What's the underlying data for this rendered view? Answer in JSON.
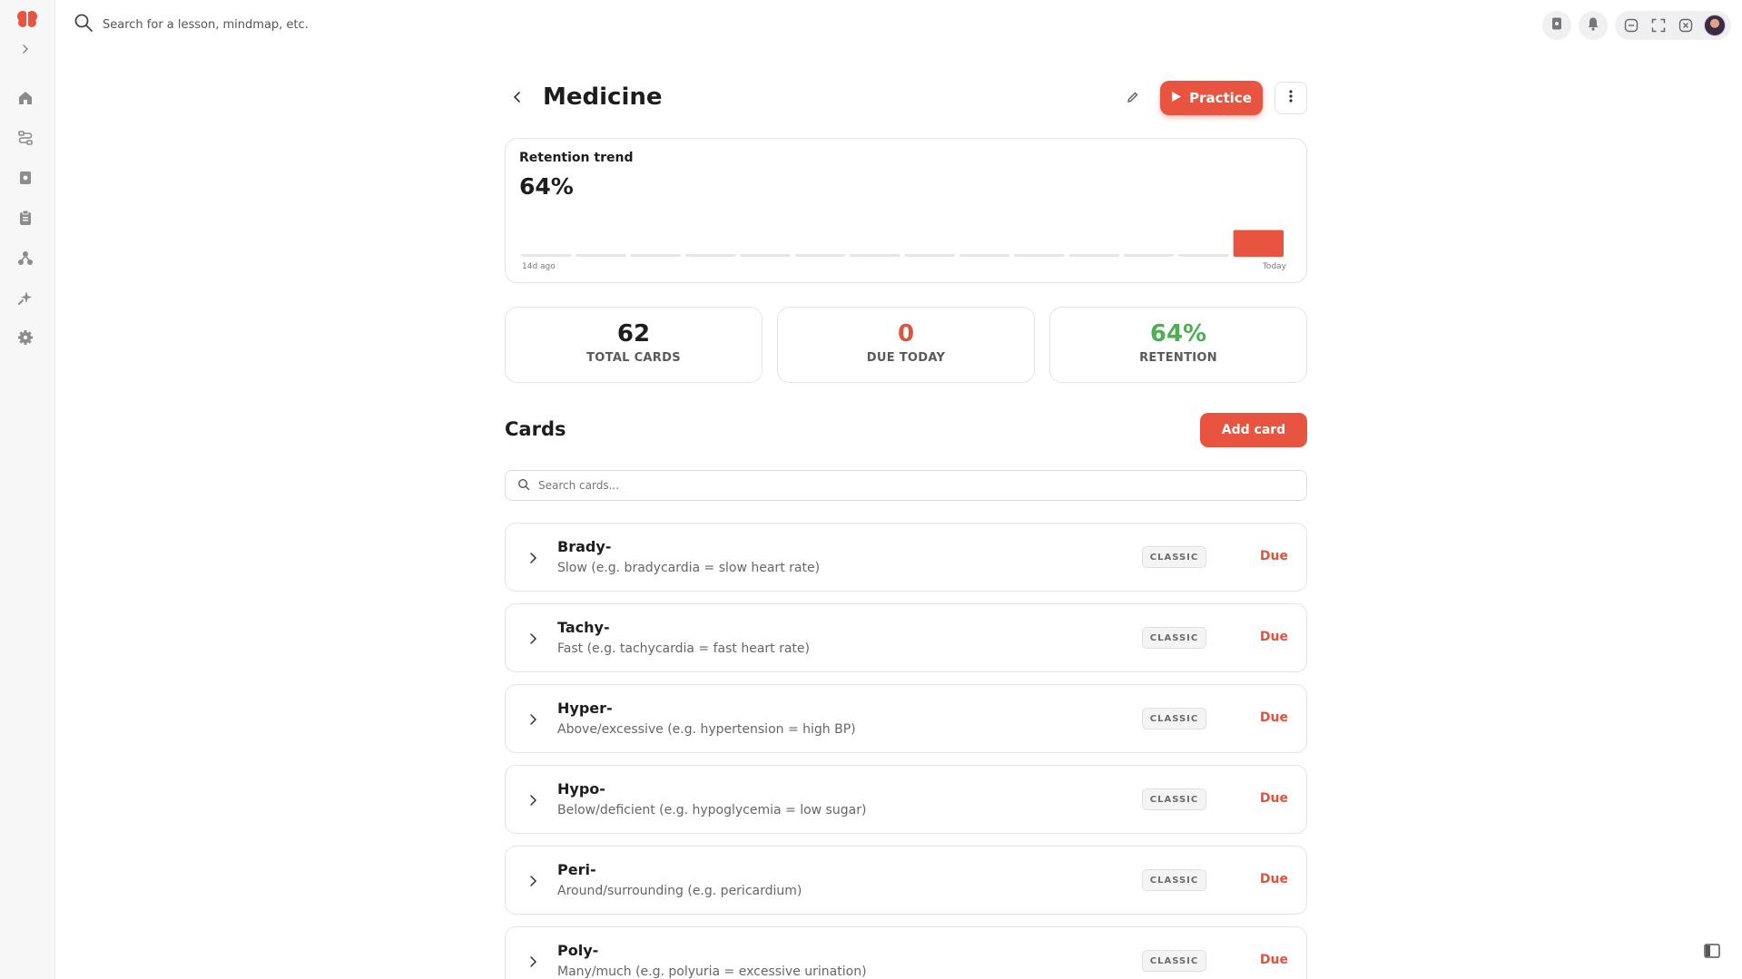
{
  "topbar": {
    "search_placeholder": "Search for a lesson, mindmap, etc."
  },
  "sidebar": {
    "items": [
      {
        "icon": "home-icon"
      },
      {
        "icon": "flow-icon"
      },
      {
        "icon": "deck-icon"
      },
      {
        "icon": "clipboard-icon"
      },
      {
        "icon": "mindmap-icon"
      },
      {
        "icon": "sparkle-icon"
      },
      {
        "icon": "gear-icon"
      }
    ]
  },
  "deck": {
    "title": "Medicine",
    "practice_label": "Practice"
  },
  "trend": {
    "label": "Retention trend",
    "value": "64%",
    "axis_start": "14d ago",
    "axis_end": "Today",
    "days": 14,
    "today_value": 64
  },
  "stats": [
    {
      "value": "62",
      "label": "TOTAL CARDS",
      "color": "#1d1d1f"
    },
    {
      "value": "0",
      "label": "DUE TODAY",
      "color": "#e0533f"
    },
    {
      "value": "64%",
      "label": "RETENTION",
      "color": "#4caf50"
    }
  ],
  "cards_section": {
    "heading": "Cards",
    "add_label": "Add card",
    "search_placeholder": "Search cards..."
  },
  "cards": [
    {
      "front": "Brady-",
      "back": "Slow (e.g. bradycardia = slow heart rate)",
      "type": "CLASSIC",
      "status": "Due"
    },
    {
      "front": "Tachy-",
      "back": "Fast (e.g. tachycardia = fast heart rate)",
      "type": "CLASSIC",
      "status": "Due"
    },
    {
      "front": "Hyper-",
      "back": "Above/excessive (e.g. hypertension = high BP)",
      "type": "CLASSIC",
      "status": "Due"
    },
    {
      "front": "Hypo-",
      "back": "Below/deficient (e.g. hypoglycemia = low sugar)",
      "type": "CLASSIC",
      "status": "Due"
    },
    {
      "front": "Peri-",
      "back": "Around/surrounding (e.g. pericardium)",
      "type": "CLASSIC",
      "status": "Due"
    },
    {
      "front": "Poly-",
      "back": "Many/much (e.g. polyuria = excessive urination)",
      "type": "CLASSIC",
      "status": "Due"
    }
  ],
  "colors": {
    "accent": "#e8543f",
    "bar_empty": "#e6e6e6",
    "retention_green": "#4caf50"
  }
}
